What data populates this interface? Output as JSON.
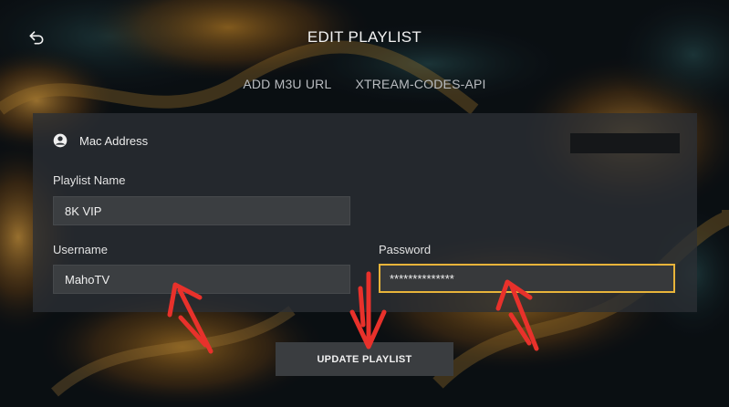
{
  "header": {
    "title": "EDIT PLAYLIST",
    "back_icon": "back-arrow-icon"
  },
  "tabs": [
    {
      "label": "ADD M3U URL"
    },
    {
      "label": "XTREAM-CODES-API"
    }
  ],
  "form": {
    "mac_address_label": "Mac Address",
    "mac_address_icon": "user-circle-icon",
    "playlist_name_label": "Playlist Name",
    "playlist_name_value": "8K VIP",
    "username_label": "Username",
    "username_value": "MahoTV",
    "password_label": "Password",
    "password_value": "**************"
  },
  "actions": {
    "update_label": "UPDATE PLAYLIST"
  },
  "colors": {
    "focus_border": "#e8b43a",
    "annotation_arrow": "#e8312b",
    "panel_bg": "#2c3034"
  }
}
